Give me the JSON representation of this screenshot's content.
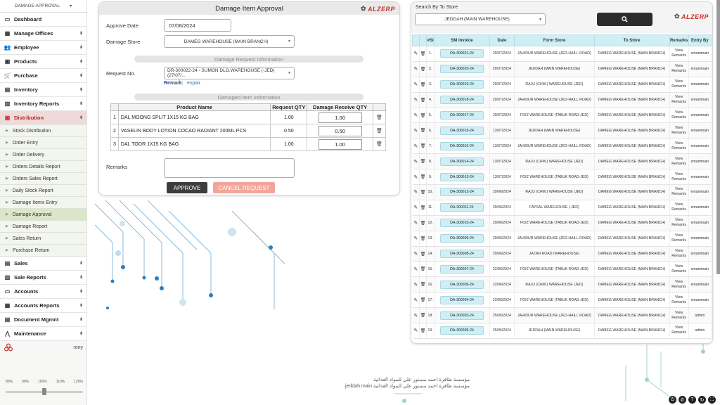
{
  "sidebar": {
    "top_label": "DAMAGE APPROVAL",
    "menu": [
      {
        "label": "Dashboard",
        "icon": "monitor-icon",
        "glyph": "▭",
        "arrow": ""
      },
      {
        "label": "Manage Offices",
        "icon": "building-icon",
        "glyph": "▦",
        "arrow": "⌄"
      },
      {
        "label": "Employee",
        "icon": "users-icon",
        "glyph": "👥",
        "arrow": "⌄"
      },
      {
        "label": "Products",
        "icon": "box-icon",
        "glyph": "▣",
        "arrow": "⌄"
      },
      {
        "label": "Purchase",
        "icon": "cart-icon",
        "glyph": "🛒",
        "arrow": "⌄"
      },
      {
        "label": "Inventory",
        "icon": "inventory-icon",
        "glyph": "▤",
        "arrow": "⌄"
      },
      {
        "label": "Inventory Reports",
        "icon": "bar-chart-icon",
        "glyph": "▥",
        "arrow": "⌄"
      },
      {
        "label": "Distribution",
        "icon": "distribution-icon",
        "glyph": "▣",
        "arrow": "⌄"
      }
    ],
    "submenu": [
      "Stock Distribution",
      "Order Entry",
      "Order Delivery",
      "Orders Details Report",
      "Orders Sales Report",
      "Daily Stock Report",
      "Damage Items Entry",
      "Damage Approval",
      "Damage Report",
      "Sales Return",
      "Purchase Return"
    ],
    "menu2": [
      {
        "label": "Sales",
        "icon": "sales-icon",
        "glyph": "▤"
      },
      {
        "label": "Sale Reports",
        "icon": "report-icon",
        "glyph": "▥"
      },
      {
        "label": "Accounts",
        "icon": "accounts-icon",
        "glyph": "▭"
      },
      {
        "label": "Accounts Reports",
        "icon": "accounts-report-icon",
        "glyph": "▦"
      },
      {
        "label": "Document Mgmnt",
        "icon": "document-icon",
        "glyph": "▤"
      },
      {
        "label": "Maintenance",
        "icon": "wrench-icon",
        "glyph": "⋀"
      }
    ],
    "user": "rony",
    "zoom_levels": [
      "80%",
      "90%",
      "100%",
      "110%",
      "120%"
    ],
    "zoom_value": "100%"
  },
  "approval": {
    "title": "Damage Item Approval",
    "logo_text": "ALZERP",
    "approve_date_label": "Approve Date",
    "approve_date_value": "07/08/2024",
    "damage_store_label": "Damage Store",
    "damage_store_value": "DAMEG WAREHOUSE (MAIN BRANCH)",
    "request_section": "Damage Request Information",
    "request_no_label": "Request No.",
    "request_no_value": "DR-300022-24 - SUMON DLO.WAREHOUSE (-JED) (27/07/...",
    "remark_label": "Remark:",
    "remark_value": "expair",
    "items_section": "Damaged Item Information",
    "columns": [
      "Product Name",
      "Request QTY",
      "Damage Receive QTY"
    ],
    "items": [
      {
        "sl": "1",
        "name": "DAL MOONG SPLIT 1X15 KG BAG",
        "req": "1.00",
        "recv": "1.00"
      },
      {
        "sl": "2",
        "name": "VASELIN BODY LOTION COCAO RADIANT 200ML PCS",
        "req": "0.50",
        "recv": "0.50"
      },
      {
        "sl": "3",
        "name": "DAL TOOR 1X15 KG BAG",
        "req": "1.00",
        "recv": "1.00"
      }
    ],
    "remarks_label": "Remarks",
    "approve_btn": "APPROVE",
    "cancel_btn": "CANCEL REQUEST"
  },
  "store_panel": {
    "search_label": "Search By To Store",
    "store_value": "JEDDAH (MAIN WAREHOUSE)",
    "logo_text": "ALZERP",
    "columns": [
      "#Sl",
      "SM Invoice",
      "Date",
      "Form Store",
      "To Store",
      "Remarks",
      "Entry By"
    ],
    "rows": [
      {
        "sl": "1.",
        "inv": "DA-300021-24",
        "date": "20/07/2024",
        "from": "JAHIDUR WAREHOUSE (JED-HAILL ROAD)",
        "to": "DAMEG WAREHOUSE (MAIN BRANCH)",
        "entry": "emammain"
      },
      {
        "sl": "2.",
        "inv": "DA-300020-24",
        "date": "20/07/2024",
        "from": "JEDDAH (MAIN WAREHOUSE)",
        "to": "DAMEG WAREHOUSE (MAIN BRANCH)",
        "entry": "emammain"
      },
      {
        "sl": "3.",
        "inv": "DA-300019-24",
        "date": "20/07/2024",
        "from": "RAJU (CHW.) WAREHOUSE (JED)",
        "to": "DAMEG WAREHOUSE (MAIN BRANCH)",
        "entry": "emammain"
      },
      {
        "sl": "4.",
        "inv": "DA-300018-24",
        "date": "20/07/2024",
        "from": "JAHIDUR WAREHOUSE (JED-HAILL ROAD)",
        "to": "DAMEG WAREHOUSE (MAIN BRANCH)",
        "entry": "emammain"
      },
      {
        "sl": "5.",
        "inv": "DA-300017-24",
        "date": "20/07/2024",
        "from": "FOIZ WAREHOUSE (TABUK ROAD-JED)",
        "to": "DAMEG WAREHOUSE (MAIN BRANCH)",
        "entry": "emammain"
      },
      {
        "sl": "6.",
        "inv": "DA-300016-24",
        "date": "13/07/2024",
        "from": "JEDDAH (MAIN WAREHOUSE)",
        "to": "DAMEG WAREHOUSE (MAIN BRANCH)",
        "entry": "emammain"
      },
      {
        "sl": "7.",
        "inv": "DA-300015-24",
        "date": "13/07/2024",
        "from": "JAHIDUR WAREHOUSE (JED-HAILL ROAD)",
        "to": "DAMEG WAREHOUSE (MAIN BRANCH)",
        "entry": "emammain"
      },
      {
        "sl": "8.",
        "inv": "DA-300014-24",
        "date": "13/07/2024",
        "from": "RAJU (CHW.) WAREHOUSE (JED)",
        "to": "DAMEG WAREHOUSE (MAIN BRANCH)",
        "entry": "emammain"
      },
      {
        "sl": "9.",
        "inv": "DA-300013-24",
        "date": "13/07/2024",
        "from": "FOIZ WAREHOUSE (TABUK ROAD-JED)",
        "to": "DAMEG WAREHOUSE (MAIN BRANCH)",
        "entry": "emammain"
      },
      {
        "sl": "10.",
        "inv": "DA-300012-24",
        "date": "29/06/2024",
        "from": "RAJU (CHW.) WAREHOUSE (JED)",
        "to": "DAMEG WAREHOUSE (MAIN BRANCH)",
        "entry": "emammain"
      },
      {
        "sl": "11.",
        "inv": "DA-300011-24",
        "date": "29/06/2024",
        "from": "FAYSAL WAREHOUSE (-JED)",
        "to": "DAMEG WAREHOUSE (MAIN BRANCH)",
        "entry": "emammain"
      },
      {
        "sl": "12.",
        "inv": "DA-300010-24",
        "date": "29/06/2024",
        "from": "FOIZ WAREHOUSE (TABUK ROAD-JED)",
        "to": "DAMEG WAREHOUSE (MAIN BRANCH)",
        "entry": "emammain"
      },
      {
        "sl": "13.",
        "inv": "DA-300009-24",
        "date": "29/06/2024",
        "from": "JAHIDUR WAREHOUSE (JED-HAILL ROAD)",
        "to": "DAMEG WAREHOUSE (MAIN BRANCH)",
        "entry": "emammain"
      },
      {
        "sl": "14.",
        "inv": "DA-300008-24",
        "date": "29/06/2024",
        "from": "JAZAN ROAD (WAREHOUSE)",
        "to": "DAMEG WAREHOUSE (MAIN BRANCH)",
        "entry": "emammain"
      },
      {
        "sl": "15.",
        "inv": "DA-300007-24",
        "date": "22/06/2024",
        "from": "FOIZ WAREHOUSE (TABUK ROAD-JED)",
        "to": "DAMEG WAREHOUSE (MAIN BRANCH)",
        "entry": "emammain"
      },
      {
        "sl": "16.",
        "inv": "DA-300006-24",
        "date": "22/06/2024",
        "from": "RAJU (CHW.) WAREHOUSE (JED)",
        "to": "DAMEG WAREHOUSE (MAIN BRANCH)",
        "entry": "emammain"
      },
      {
        "sl": "17.",
        "inv": "DA-300004-24",
        "date": "22/06/2024",
        "from": "FOIZ WAREHOUSE (TABUK ROAD-JED)",
        "to": "DAMEG WAREHOUSE (MAIN BRANCH)",
        "entry": "emammain"
      },
      {
        "sl": "18.",
        "inv": "DA-300003-24",
        "date": "25/05/2024",
        "from": "JAHIDUR WAREHOUSE (JED-HAILL ROAD)",
        "to": "DAMEG WAREHOUSE (MAIN BRANCH)",
        "entry": "admin"
      },
      {
        "sl": "19.",
        "inv": "DA-300005-24",
        "date": "25/05/2024",
        "from": "JEDDAH (MAIN WAREHOUSE)",
        "to": "DAMEG WAREHOUSE (MAIN BRANCH)",
        "entry": "admin"
      }
    ],
    "view_label_1": "View",
    "view_label_2": "Remarks"
  },
  "footer": {
    "line1": "مؤسسة طافرة احمد مستور علي للمواد الغذائية",
    "line2": "jeddah main مؤسسة طافرة احمد مستور علي للمواد الغذائية"
  },
  "colors": {
    "accent_red": "#c8352b",
    "table_head": "#cfeff5",
    "dark_button": "#3d3d3d",
    "cancel_button": "#f2a59a"
  }
}
